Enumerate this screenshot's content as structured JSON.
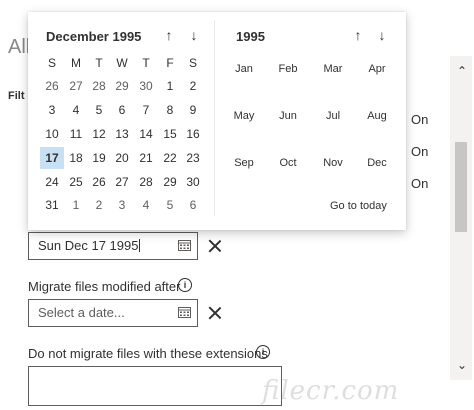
{
  "background": {
    "heading": "All",
    "filter_label": "Filt",
    "on_labels": [
      "On",
      "On",
      "On"
    ]
  },
  "calendar": {
    "month_title": "December 1995",
    "weekday_headers": [
      "S",
      "M",
      "T",
      "W",
      "T",
      "F",
      "S"
    ],
    "weeks": [
      [
        {
          "d": "26",
          "o": true
        },
        {
          "d": "27",
          "o": true
        },
        {
          "d": "28",
          "o": true
        },
        {
          "d": "29",
          "o": true
        },
        {
          "d": "30",
          "o": true
        },
        {
          "d": "1"
        },
        {
          "d": "2"
        }
      ],
      [
        {
          "d": "3"
        },
        {
          "d": "4"
        },
        {
          "d": "5"
        },
        {
          "d": "6"
        },
        {
          "d": "7"
        },
        {
          "d": "8"
        },
        {
          "d": "9"
        }
      ],
      [
        {
          "d": "10"
        },
        {
          "d": "11"
        },
        {
          "d": "12"
        },
        {
          "d": "13"
        },
        {
          "d": "14"
        },
        {
          "d": "15"
        },
        {
          "d": "16"
        }
      ],
      [
        {
          "d": "17",
          "selected": true
        },
        {
          "d": "18"
        },
        {
          "d": "19"
        },
        {
          "d": "20"
        },
        {
          "d": "21"
        },
        {
          "d": "22"
        },
        {
          "d": "23"
        }
      ],
      [
        {
          "d": "24"
        },
        {
          "d": "25"
        },
        {
          "d": "26"
        },
        {
          "d": "27"
        },
        {
          "d": "28"
        },
        {
          "d": "29"
        },
        {
          "d": "30"
        }
      ],
      [
        {
          "d": "31"
        },
        {
          "d": "1",
          "o": true
        },
        {
          "d": "2",
          "o": true
        },
        {
          "d": "3",
          "o": true
        },
        {
          "d": "4",
          "o": true
        },
        {
          "d": "5",
          "o": true
        },
        {
          "d": "6",
          "o": true
        }
      ]
    ],
    "year_title": "1995",
    "months": [
      "Jan",
      "Feb",
      "Mar",
      "Apr",
      "May",
      "Jun",
      "Jul",
      "Aug",
      "Sep",
      "Oct",
      "Nov",
      "Dec"
    ],
    "go_to_today": "Go to today",
    "icons": {
      "up": "arrow-up-icon",
      "down": "arrow-down-icon"
    }
  },
  "form": {
    "selected_date_value": "Sun Dec 17 1995",
    "modified_after_label": "Migrate files modified after",
    "modified_after_placeholder": "Select a date...",
    "extensions_label": "Do not migrate files with these extensions"
  },
  "colors": {
    "selected_day_bg": "#c7e0f4",
    "border": "#605e5c",
    "text": "#323130"
  }
}
